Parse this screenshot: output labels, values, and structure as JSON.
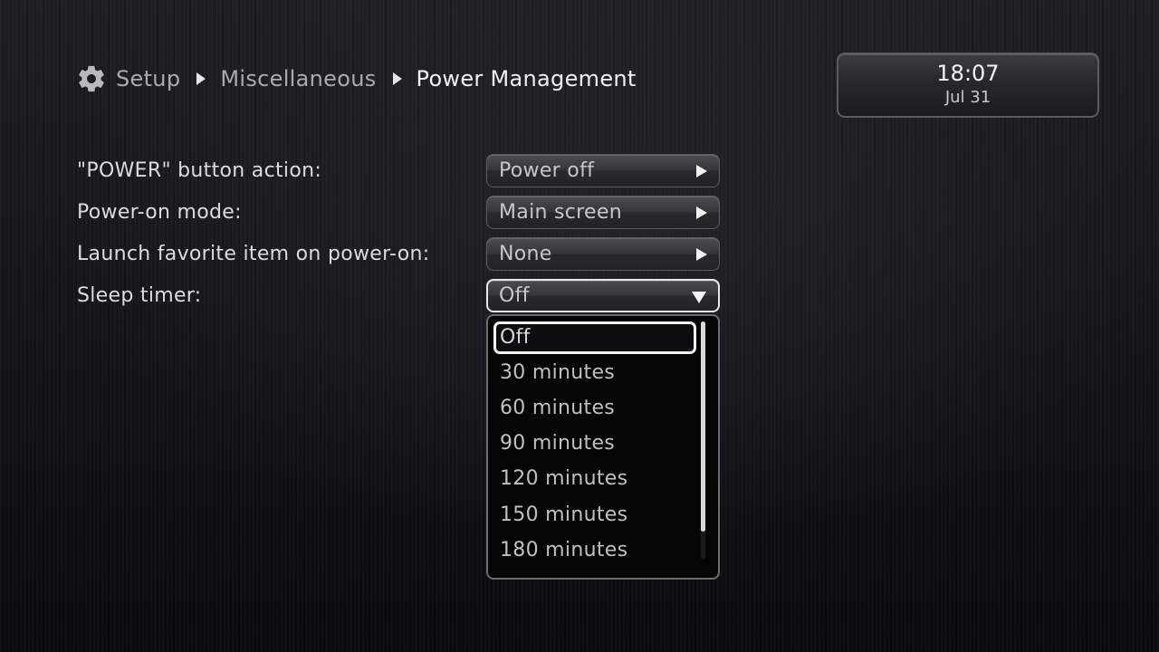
{
  "breadcrumb": {
    "icon": "gear-icon",
    "items": [
      "Setup",
      "Miscellaneous",
      "Power Management"
    ]
  },
  "clock": {
    "time": "18:07",
    "date": "Jul 31"
  },
  "settings": [
    {
      "label": "\"POWER\" button action:",
      "value": "Power off"
    },
    {
      "label": "Power-on mode:",
      "value": "Main screen"
    },
    {
      "label": "Launch favorite item on power-on:",
      "value": "None"
    },
    {
      "label": "Sleep timer:",
      "value": "Off"
    }
  ],
  "sleep_timer_dropdown": {
    "selected": "Off",
    "options": [
      "Off",
      "30 minutes",
      "60 minutes",
      "90 minutes",
      "120 minutes",
      "150 minutes",
      "180 minutes"
    ]
  },
  "colors": {
    "accent": "#f2f2f2",
    "background": "#141416"
  }
}
